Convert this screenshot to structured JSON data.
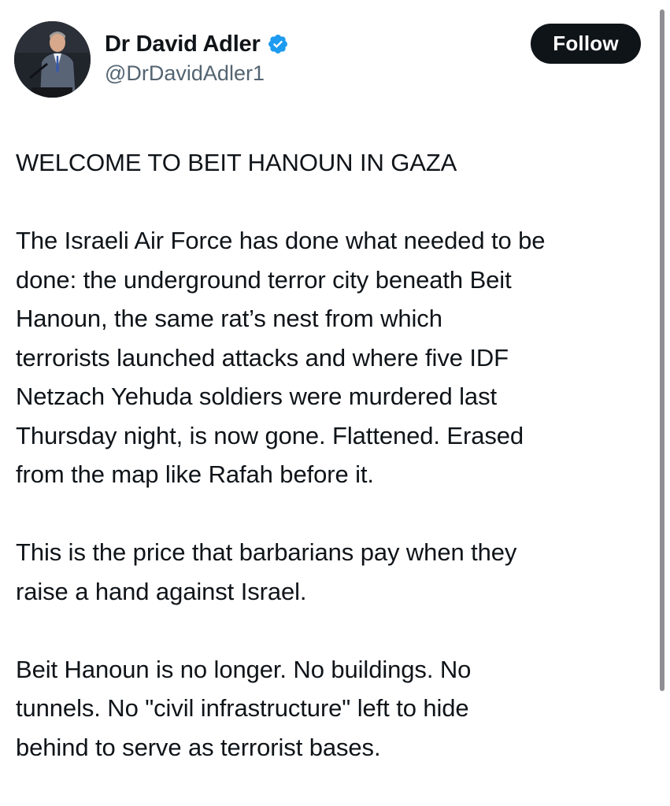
{
  "author": {
    "display_name": "Dr David Adler",
    "handle": "@DrDavidAdler1",
    "verified": true,
    "avatar_icon": "person-at-podium-avatar"
  },
  "actions": {
    "follow_label": "Follow"
  },
  "tweet": {
    "paragraphs": [
      "WELCOME TO BEIT HANOUN IN GAZA",
      "The Israeli Air Force has done what needed to be\ndone: the underground terror city beneath Beit\nHanoun, the same rat’s nest from which\nterrorists launched attacks and where five IDF\nNetzach Yehuda soldiers were murdered last\nThursday night, is now gone. Flattened. Erased\nfrom the map like Rafah before it.",
      "This is the price that barbarians pay when they\nraise a hand against Israel.",
      "Beit Hanoun is no longer. No buildings. No\ntunnels. No \"civil infrastructure\" left to hide\nbehind to serve as terrorist bases."
    ]
  },
  "colors": {
    "text": "#0f1419",
    "secondary_text": "#536471",
    "follow_bg": "#0f1419",
    "verified_blue": "#1d9bf0"
  }
}
